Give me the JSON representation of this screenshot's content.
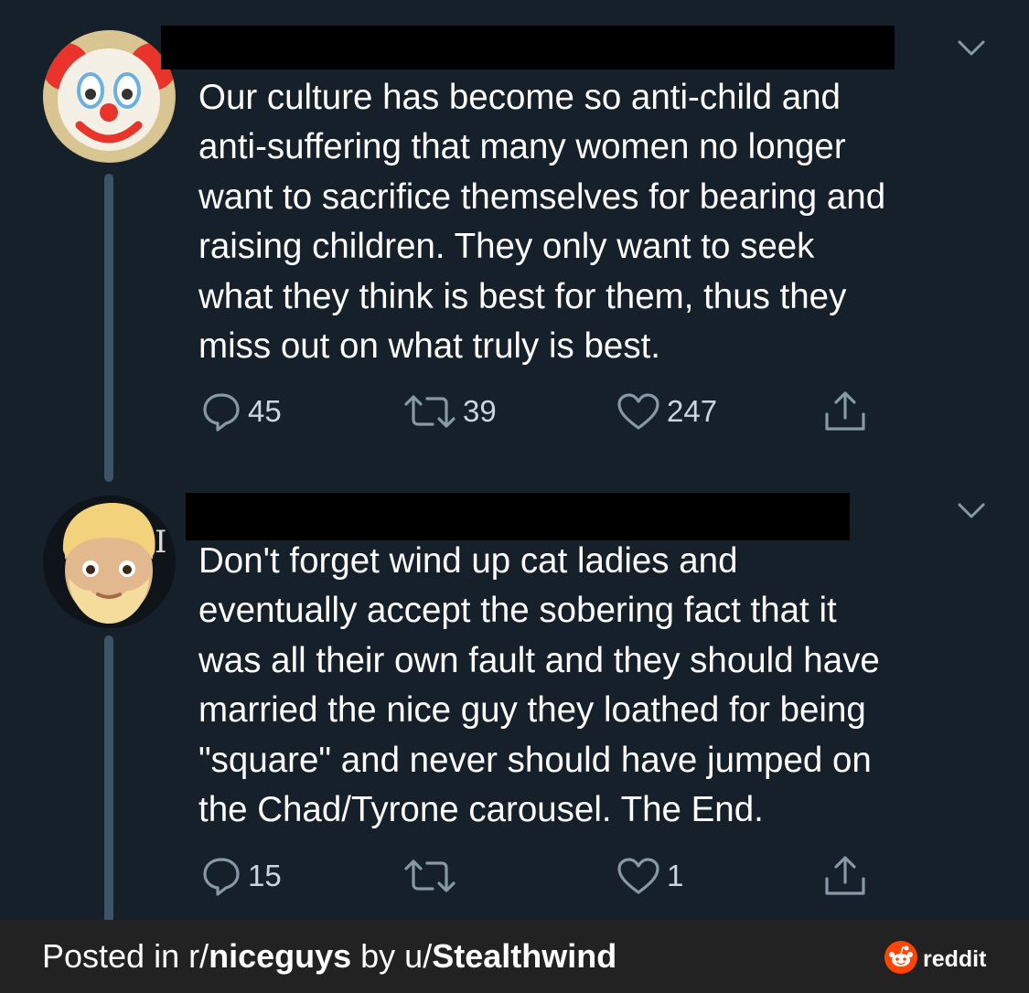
{
  "tweets": [
    {
      "avatar_icon": "clown-face-icon",
      "text": "Our culture has become so anti-child and\nanti-suffering that many women no longer\nwant to sacrifice themselves for bearing and\nraising children. They only want to seek\nwhat they think is best for them, thus they\nmiss out on what truly is best.",
      "reply_count": "45",
      "retweet_count": "39",
      "like_count": "247"
    },
    {
      "avatar_icon": "bearded-blond-man-icon",
      "text": "Don't forget wind up cat ladies and\neventually accept the sobering fact that it\nwas all their own fault and they should have\nmarried the nice guy they loathed for being\n\"square\" and never should have jumped on\nthe Chad/Tyrone carousel. The End.",
      "reply_count": "15",
      "retweet_count": "",
      "like_count": "1"
    }
  ],
  "footer": {
    "posted_in_label": "Posted in r/",
    "subreddit": "niceguys",
    "by_label": " by u/",
    "username": "Stealthwind",
    "brand": "reddit"
  },
  "colors": {
    "background": "#15202b",
    "icon_gray": "#8899a6",
    "thread_line": "#3d5466",
    "footer_bg": "#222222",
    "reddit_orange": "#ff4500"
  }
}
